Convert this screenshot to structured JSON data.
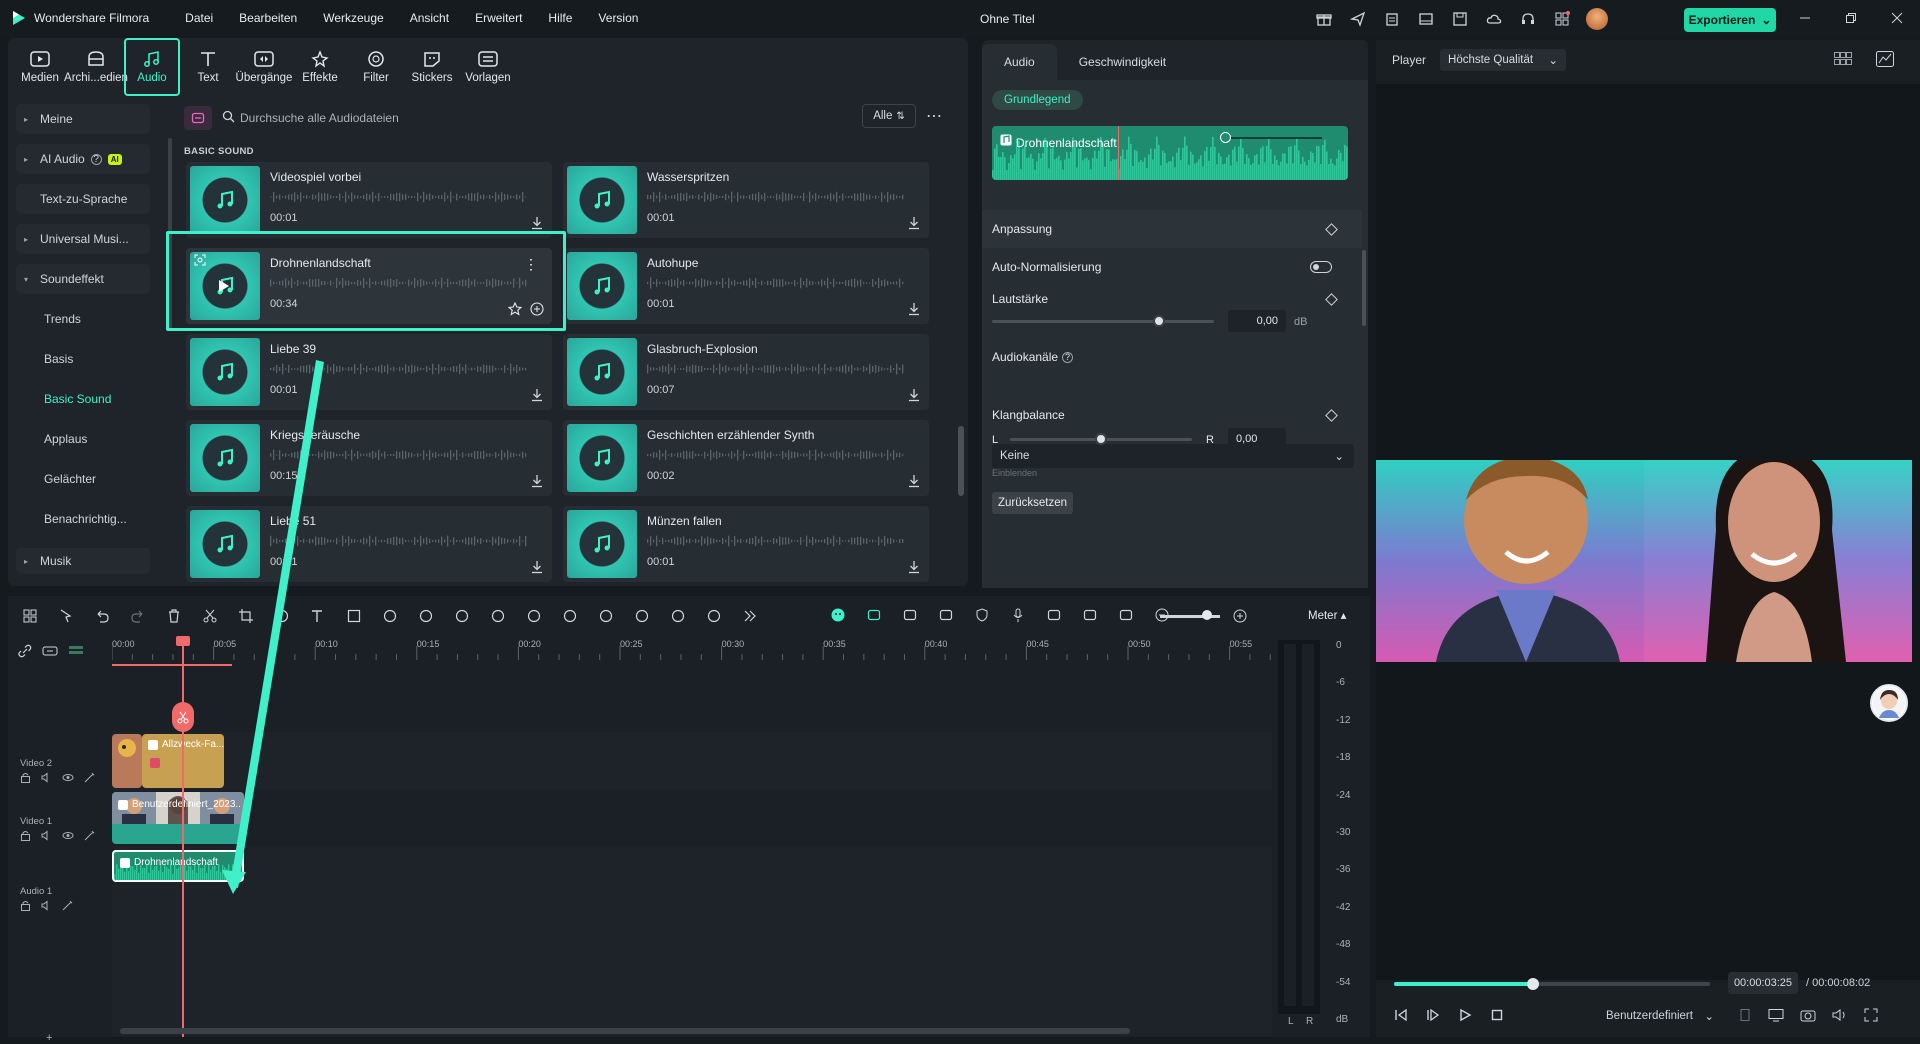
{
  "app": {
    "name": "Wondershare Filmora",
    "doc_title": "Ohne Titel",
    "export_label": "Exportieren",
    "accent": "#3ff0c9"
  },
  "menu": [
    "Datei",
    "Bearbeiten",
    "Werkzeuge",
    "Ansicht",
    "Erweitert",
    "Hilfe",
    "Version"
  ],
  "media_tabs": [
    {
      "label": "Medien",
      "icon": "media-icon"
    },
    {
      "label": "Archi...edien",
      "icon": "archive-icon"
    },
    {
      "label": "Audio",
      "icon": "music-note-icon",
      "active": true
    },
    {
      "label": "Text",
      "icon": "text-icon"
    },
    {
      "label": "Übergänge",
      "icon": "transition-icon"
    },
    {
      "label": "Effekte",
      "icon": "effects-icon"
    },
    {
      "label": "Filter",
      "icon": "filter-icon"
    },
    {
      "label": "Stickers",
      "icon": "sticker-icon"
    },
    {
      "label": "Vorlagen",
      "icon": "template-icon"
    }
  ],
  "sidebar": {
    "items": [
      {
        "label": "Meine"
      },
      {
        "label": "AI Audio",
        "badge": "AI"
      },
      {
        "label": "Text-zu-Sprache"
      },
      {
        "label": "Universal Musi..."
      },
      {
        "label": "Soundeffekt"
      },
      {
        "label": "Trends"
      },
      {
        "label": "Basis"
      },
      {
        "label": "Basic Sound"
      },
      {
        "label": "Applaus"
      },
      {
        "label": "Gelächter"
      },
      {
        "label": "Benachrichtig..."
      },
      {
        "label": "Musik"
      }
    ]
  },
  "search": {
    "placeholder": "Durchsuche alle Audiodateien",
    "filter_label": "Alle"
  },
  "section_label": "BASIC SOUND",
  "sounds": [
    {
      "name": "Videospiel vorbei",
      "duration": "00:01"
    },
    {
      "name": "Wasserspritzen",
      "duration": "00:01"
    },
    {
      "name": "Drohnenlandschaft",
      "duration": "00:34",
      "selected": true
    },
    {
      "name": "Autohupe",
      "duration": "00:01"
    },
    {
      "name": "Liebe 39",
      "duration": "00:01"
    },
    {
      "name": "Glasbruch-Explosion",
      "duration": "00:07"
    },
    {
      "name": "Kriegsgeräusche",
      "duration": "00:15"
    },
    {
      "name": "Geschichten erzählender Synth",
      "duration": "00:02"
    },
    {
      "name": "Liebe 51",
      "duration": "00:01"
    },
    {
      "name": "Münzen fallen",
      "duration": "00:01"
    }
  ],
  "properties": {
    "tabs": [
      "Audio",
      "Geschwindigkeit"
    ],
    "chip": "Grundlegend",
    "clip_name": "Drohnenlandschaft",
    "section_adjust": "Anpassung",
    "auto_norm": "Auto-Normalisierung",
    "volume_label": "Lautstärke",
    "volume_value": "0,00",
    "volume_unit": "dB",
    "volume_level": 0.75,
    "channels_label": "Audiokanäle",
    "channels_value": "Keine",
    "balance_label": "Klangbalance",
    "balance_left": "L",
    "balance_right": "R",
    "balance_value": "0,00",
    "balance_level": 0.5,
    "fade_label": "Einblenden",
    "reset_label": "Zurücksetzen"
  },
  "player": {
    "label": "Player",
    "quality": "Höchste Qualität",
    "time_current": "00:00:03:25",
    "time_total": "/  00:00:08:02",
    "progress": 0.44,
    "resolution_mode": "Benutzerdefiniert"
  },
  "timeline": {
    "meter_label": "Meter",
    "ruler": [
      "00:00",
      "00:05",
      "00:10",
      "00:15",
      "00:20",
      "00:25",
      "00:30",
      "00:35",
      "00:40",
      "00:45",
      "00:50",
      "00:55"
    ],
    "tracks": [
      {
        "label": "Video 2",
        "clip": "Allzweck-Fa..."
      },
      {
        "label": "Video 1",
        "clip": "Benutzerdefiniert_2023..."
      },
      {
        "label": "Audio 1",
        "clip": "Drohnenlandschaft"
      }
    ],
    "meter_scale": [
      "0",
      "-6",
      "-12",
      "-18",
      "-24",
      "-30",
      "-36",
      "-42",
      "-48",
      "-54",
      "dB"
    ],
    "meter_lr": [
      "L",
      "R"
    ]
  }
}
